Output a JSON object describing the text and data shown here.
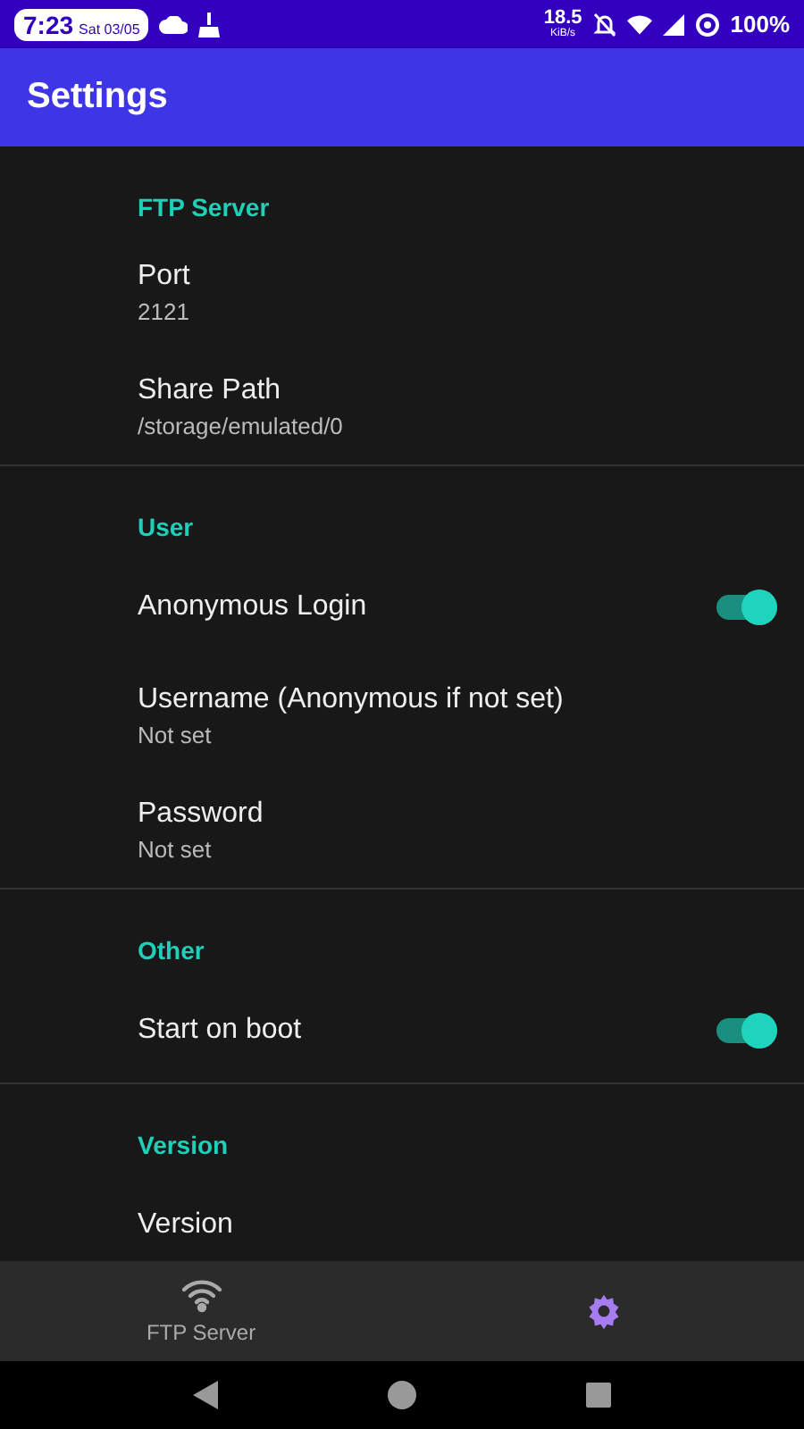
{
  "status_bar": {
    "time": "7:23",
    "date": "Sat 03/05",
    "speed": "18.5",
    "speed_unit": "KiB/s",
    "battery": "100%"
  },
  "app_bar": {
    "title": "Settings"
  },
  "sections": [
    {
      "title": "FTP Server",
      "items": [
        {
          "kind": "text",
          "title": "Port",
          "summary": "2121"
        },
        {
          "kind": "text",
          "title": "Share Path",
          "summary": "/storage/emulated/0"
        }
      ]
    },
    {
      "title": "User",
      "items": [
        {
          "kind": "switch",
          "title": "Anonymous Login",
          "on": true
        },
        {
          "kind": "text",
          "title": "Username (Anonymous if not set)",
          "summary": "Not set"
        },
        {
          "kind": "text",
          "title": "Password",
          "summary": "Not set"
        }
      ]
    },
    {
      "title": "Other",
      "items": [
        {
          "kind": "switch",
          "title": "Start on boot",
          "on": true
        }
      ]
    },
    {
      "title": "Version",
      "items": [
        {
          "kind": "text",
          "title": "Version"
        }
      ]
    }
  ],
  "bottom_nav": [
    {
      "label": "FTP Server",
      "selected": false
    },
    {
      "selected": true
    }
  ]
}
